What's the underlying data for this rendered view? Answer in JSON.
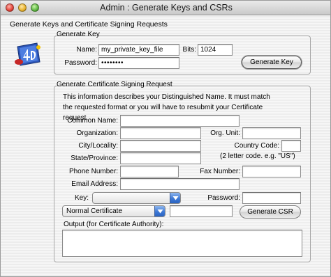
{
  "window": {
    "title": "Admin : Generate Keys and CSRs"
  },
  "page": {
    "title": "Generate Keys and Certificate Signing Requests"
  },
  "generate_key": {
    "group_title": "Generate Key",
    "name_label": "Name:",
    "name_value": "my_private_key_file",
    "bits_label": "Bits:",
    "bits_value": "1024",
    "password_label": "Password:",
    "password_value": "••••••••",
    "button_label": "Generate Key"
  },
  "csr": {
    "group_title": "Generate Certificate Signing Request",
    "description": "This information describes your Distinguished Name. It must match the requested format or you will have to resubmit your Certificate request.",
    "common_name_label": "Common Name:",
    "common_name_value": "",
    "organization_label": "Organization:",
    "organization_value": "",
    "org_unit_label": "Org. Unit:",
    "org_unit_value": "",
    "city_label": "City/Locality:",
    "city_value": "",
    "country_label": "Country Code:",
    "country_value": "",
    "country_hint": "(2 letter code. e.g. \"US\")",
    "state_label": "State/Province:",
    "state_value": "",
    "phone_label": "Phone Number:",
    "phone_value": "",
    "fax_label": "Fax Number:",
    "fax_value": "",
    "email_label": "Email Address:",
    "email_value": "",
    "key_label": "Key:",
    "key_value": "",
    "key_password_label": "Password:",
    "key_password_value": "",
    "certificate_type": "Normal Certificate",
    "certificate_extra_value": "",
    "button_label": "Generate CSR",
    "output_label": "Output (for Certificate Authority):",
    "output_value": ""
  }
}
